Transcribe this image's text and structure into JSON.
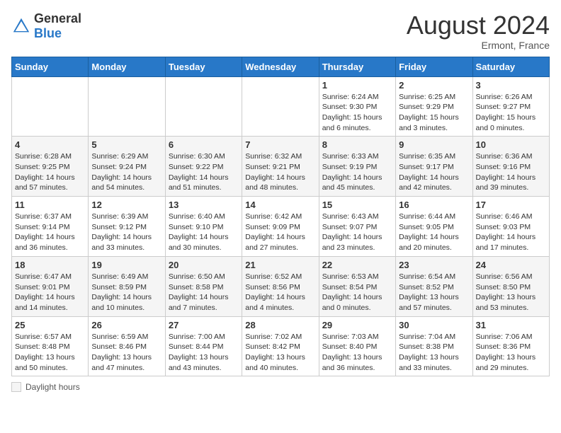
{
  "header": {
    "logo_general": "General",
    "logo_blue": "Blue",
    "month_year": "August 2024",
    "location": "Ermont, France"
  },
  "days_of_week": [
    "Sunday",
    "Monday",
    "Tuesday",
    "Wednesday",
    "Thursday",
    "Friday",
    "Saturday"
  ],
  "legend_label": "Daylight hours",
  "weeks": [
    [
      {
        "day": "",
        "sunrise": "",
        "sunset": "",
        "daylight": ""
      },
      {
        "day": "",
        "sunrise": "",
        "sunset": "",
        "daylight": ""
      },
      {
        "day": "",
        "sunrise": "",
        "sunset": "",
        "daylight": ""
      },
      {
        "day": "",
        "sunrise": "",
        "sunset": "",
        "daylight": ""
      },
      {
        "day": "1",
        "sunrise": "Sunrise: 6:24 AM",
        "sunset": "Sunset: 9:30 PM",
        "daylight": "Daylight: 15 hours and 6 minutes."
      },
      {
        "day": "2",
        "sunrise": "Sunrise: 6:25 AM",
        "sunset": "Sunset: 9:29 PM",
        "daylight": "Daylight: 15 hours and 3 minutes."
      },
      {
        "day": "3",
        "sunrise": "Sunrise: 6:26 AM",
        "sunset": "Sunset: 9:27 PM",
        "daylight": "Daylight: 15 hours and 0 minutes."
      }
    ],
    [
      {
        "day": "4",
        "sunrise": "Sunrise: 6:28 AM",
        "sunset": "Sunset: 9:25 PM",
        "daylight": "Daylight: 14 hours and 57 minutes."
      },
      {
        "day": "5",
        "sunrise": "Sunrise: 6:29 AM",
        "sunset": "Sunset: 9:24 PM",
        "daylight": "Daylight: 14 hours and 54 minutes."
      },
      {
        "day": "6",
        "sunrise": "Sunrise: 6:30 AM",
        "sunset": "Sunset: 9:22 PM",
        "daylight": "Daylight: 14 hours and 51 minutes."
      },
      {
        "day": "7",
        "sunrise": "Sunrise: 6:32 AM",
        "sunset": "Sunset: 9:21 PM",
        "daylight": "Daylight: 14 hours and 48 minutes."
      },
      {
        "day": "8",
        "sunrise": "Sunrise: 6:33 AM",
        "sunset": "Sunset: 9:19 PM",
        "daylight": "Daylight: 14 hours and 45 minutes."
      },
      {
        "day": "9",
        "sunrise": "Sunrise: 6:35 AM",
        "sunset": "Sunset: 9:17 PM",
        "daylight": "Daylight: 14 hours and 42 minutes."
      },
      {
        "day": "10",
        "sunrise": "Sunrise: 6:36 AM",
        "sunset": "Sunset: 9:16 PM",
        "daylight": "Daylight: 14 hours and 39 minutes."
      }
    ],
    [
      {
        "day": "11",
        "sunrise": "Sunrise: 6:37 AM",
        "sunset": "Sunset: 9:14 PM",
        "daylight": "Daylight: 14 hours and 36 minutes."
      },
      {
        "day": "12",
        "sunrise": "Sunrise: 6:39 AM",
        "sunset": "Sunset: 9:12 PM",
        "daylight": "Daylight: 14 hours and 33 minutes."
      },
      {
        "day": "13",
        "sunrise": "Sunrise: 6:40 AM",
        "sunset": "Sunset: 9:10 PM",
        "daylight": "Daylight: 14 hours and 30 minutes."
      },
      {
        "day": "14",
        "sunrise": "Sunrise: 6:42 AM",
        "sunset": "Sunset: 9:09 PM",
        "daylight": "Daylight: 14 hours and 27 minutes."
      },
      {
        "day": "15",
        "sunrise": "Sunrise: 6:43 AM",
        "sunset": "Sunset: 9:07 PM",
        "daylight": "Daylight: 14 hours and 23 minutes."
      },
      {
        "day": "16",
        "sunrise": "Sunrise: 6:44 AM",
        "sunset": "Sunset: 9:05 PM",
        "daylight": "Daylight: 14 hours and 20 minutes."
      },
      {
        "day": "17",
        "sunrise": "Sunrise: 6:46 AM",
        "sunset": "Sunset: 9:03 PM",
        "daylight": "Daylight: 14 hours and 17 minutes."
      }
    ],
    [
      {
        "day": "18",
        "sunrise": "Sunrise: 6:47 AM",
        "sunset": "Sunset: 9:01 PM",
        "daylight": "Daylight: 14 hours and 14 minutes."
      },
      {
        "day": "19",
        "sunrise": "Sunrise: 6:49 AM",
        "sunset": "Sunset: 8:59 PM",
        "daylight": "Daylight: 14 hours and 10 minutes."
      },
      {
        "day": "20",
        "sunrise": "Sunrise: 6:50 AM",
        "sunset": "Sunset: 8:58 PM",
        "daylight": "Daylight: 14 hours and 7 minutes."
      },
      {
        "day": "21",
        "sunrise": "Sunrise: 6:52 AM",
        "sunset": "Sunset: 8:56 PM",
        "daylight": "Daylight: 14 hours and 4 minutes."
      },
      {
        "day": "22",
        "sunrise": "Sunrise: 6:53 AM",
        "sunset": "Sunset: 8:54 PM",
        "daylight": "Daylight: 14 hours and 0 minutes."
      },
      {
        "day": "23",
        "sunrise": "Sunrise: 6:54 AM",
        "sunset": "Sunset: 8:52 PM",
        "daylight": "Daylight: 13 hours and 57 minutes."
      },
      {
        "day": "24",
        "sunrise": "Sunrise: 6:56 AM",
        "sunset": "Sunset: 8:50 PM",
        "daylight": "Daylight: 13 hours and 53 minutes."
      }
    ],
    [
      {
        "day": "25",
        "sunrise": "Sunrise: 6:57 AM",
        "sunset": "Sunset: 8:48 PM",
        "daylight": "Daylight: 13 hours and 50 minutes."
      },
      {
        "day": "26",
        "sunrise": "Sunrise: 6:59 AM",
        "sunset": "Sunset: 8:46 PM",
        "daylight": "Daylight: 13 hours and 47 minutes."
      },
      {
        "day": "27",
        "sunrise": "Sunrise: 7:00 AM",
        "sunset": "Sunset: 8:44 PM",
        "daylight": "Daylight: 13 hours and 43 minutes."
      },
      {
        "day": "28",
        "sunrise": "Sunrise: 7:02 AM",
        "sunset": "Sunset: 8:42 PM",
        "daylight": "Daylight: 13 hours and 40 minutes."
      },
      {
        "day": "29",
        "sunrise": "Sunrise: 7:03 AM",
        "sunset": "Sunset: 8:40 PM",
        "daylight": "Daylight: 13 hours and 36 minutes."
      },
      {
        "day": "30",
        "sunrise": "Sunrise: 7:04 AM",
        "sunset": "Sunset: 8:38 PM",
        "daylight": "Daylight: 13 hours and 33 minutes."
      },
      {
        "day": "31",
        "sunrise": "Sunrise: 7:06 AM",
        "sunset": "Sunset: 8:36 PM",
        "daylight": "Daylight: 13 hours and 29 minutes."
      }
    ]
  ]
}
